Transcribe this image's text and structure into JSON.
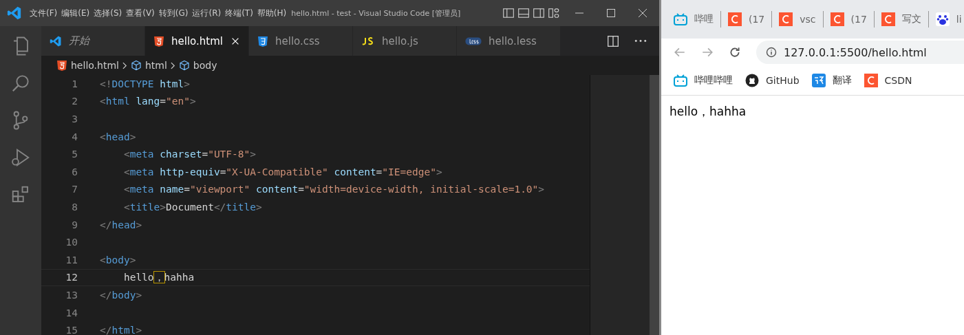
{
  "titlebar": {
    "menu": [
      "文件(F)",
      "编辑(E)",
      "选择(S)",
      "查看(V)",
      "转到(G)",
      "运行(R)",
      "终端(T)",
      "帮助(H)"
    ],
    "title": "hello.html - test - Visual Studio Code [管理员]"
  },
  "editor_tabs": [
    {
      "label": "开始",
      "kind": "welcome",
      "selected": false,
      "italic": true
    },
    {
      "label": "hello.html",
      "kind": "html",
      "selected": true,
      "italic": false
    },
    {
      "label": "hello.css",
      "kind": "css",
      "selected": false,
      "italic": false
    },
    {
      "label": "hello.js",
      "kind": "js",
      "selected": false,
      "italic": false
    },
    {
      "label": "hello.less",
      "kind": "less",
      "selected": false,
      "italic": false
    }
  ],
  "breadcrumbs": [
    {
      "label": "hello.html",
      "kind": "file"
    },
    {
      "label": "html",
      "kind": "element"
    },
    {
      "label": "body",
      "kind": "element"
    }
  ],
  "code_lines": [
    {
      "number": "1",
      "current": false,
      "code": "<!DOCTYPE html>"
    },
    {
      "number": "2",
      "current": false,
      "code": "<html lang=\"en\">"
    },
    {
      "number": "3",
      "current": false
    },
    {
      "number": "4",
      "current": false,
      "code": "<head>"
    },
    {
      "number": "5",
      "current": false,
      "code": "    <meta charset=\"UTF-8\">"
    },
    {
      "number": "6",
      "current": false,
      "code": "    <meta http-equiv=\"X-UA-Compatible\" content=\"IE=edge\">"
    },
    {
      "number": "7",
      "current": false,
      "code": "    <meta name=\"viewport\" content=\"width=device-width, initial-scale=1.0\">"
    },
    {
      "number": "8",
      "current": false,
      "code": "    <title>Document</title>"
    },
    {
      "number": "9",
      "current": false,
      "code": "</head>"
    },
    {
      "number": "10",
      "current": false
    },
    {
      "number": "11",
      "current": false,
      "code": "<body>"
    },
    {
      "number": "12",
      "current": true,
      "code": "    hello，hahha"
    },
    {
      "number": "13",
      "current": false,
      "code": "</body>"
    },
    {
      "number": "14",
      "current": false
    },
    {
      "number": "15",
      "current": false,
      "code": "</html>"
    }
  ],
  "browser": {
    "tabs": [
      {
        "label": "哔哩",
        "kind": "tv"
      },
      {
        "label": "(17",
        "kind": "c"
      },
      {
        "label": "vsc",
        "kind": "c"
      },
      {
        "label": "(17",
        "kind": "c"
      },
      {
        "label": "写文",
        "kind": "c"
      },
      {
        "label": "li",
        "kind": "paw"
      }
    ],
    "url": "127.0.0.1:5500/hello.html",
    "bookmarks": [
      {
        "label": "哔哩哔哩",
        "kind": "tv"
      },
      {
        "label": "GitHub",
        "kind": "github"
      },
      {
        "label": "翻译",
        "kind": "translate"
      },
      {
        "label": "CSDN",
        "kind": "c"
      }
    ],
    "page_text": "hello，hahha"
  }
}
